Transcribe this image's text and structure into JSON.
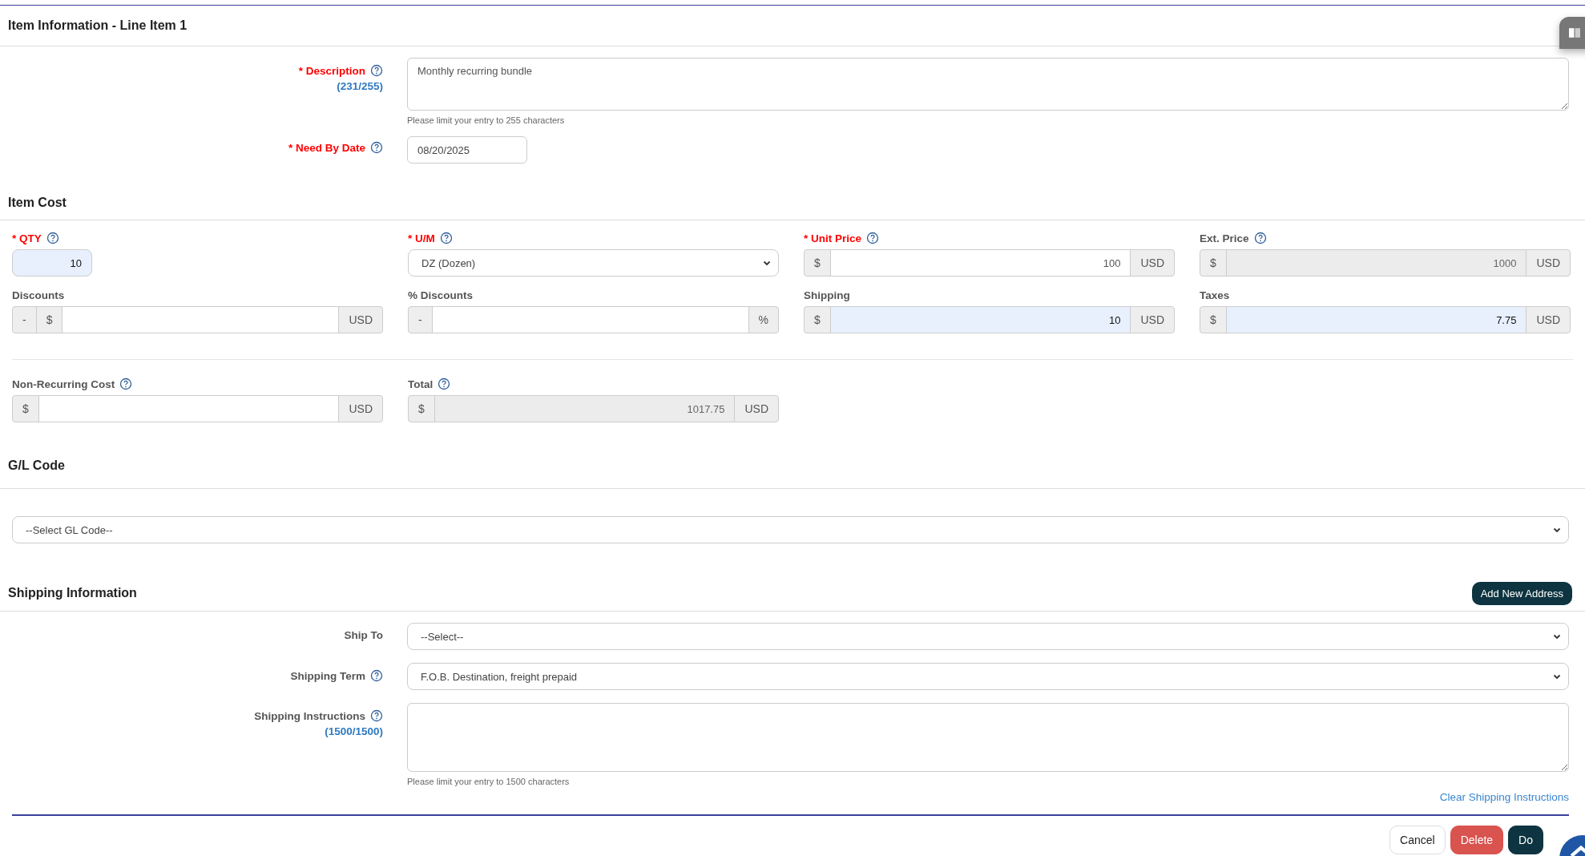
{
  "header": {
    "title": "Item Information - Line Item 1"
  },
  "item_info": [
    {
      "kind": "textarea",
      "label": "* Description",
      "required": true,
      "help": true,
      "counter": "(231/255)",
      "value": "Monthly recurring bundle",
      "hint": "Please limit your entry to 255 characters"
    },
    {
      "kind": "date",
      "label": "* Need By Date",
      "required": true,
      "help": true,
      "value": "08/20/2025"
    }
  ],
  "item_cost": {
    "title": "Item Cost",
    "groups": [
      [
        {
          "kind": "number",
          "label": "* QTY",
          "required": true,
          "help": true,
          "value": "10",
          "highlighted": true
        },
        {
          "kind": "select",
          "label": "* U/M",
          "required": true,
          "help": true,
          "value": "DZ (Dozen)"
        },
        {
          "kind": "money",
          "label": "* Unit Price",
          "required": true,
          "help": true,
          "prefix": [
            "$"
          ],
          "value": "100",
          "suffix": "USD",
          "highlighted": false,
          "readonly": false
        },
        {
          "kind": "money",
          "label": "Ext. Price",
          "required": false,
          "help": true,
          "prefix": [
            "$"
          ],
          "value": "1000",
          "suffix": "USD",
          "readonly": true
        },
        {
          "kind": "money",
          "label": "Discounts",
          "required": false,
          "prefix": [
            "-",
            "$"
          ],
          "suffix": "USD",
          "highlighted": false,
          "readonly": false
        },
        {
          "kind": "money",
          "label": "% Discounts",
          "required": false,
          "prefix": [
            "-"
          ],
          "suffix": "%",
          "highlighted": false,
          "readonly": false
        },
        {
          "kind": "money",
          "label": "Shipping",
          "required": false,
          "prefix": [
            "$"
          ],
          "value": "10",
          "suffix": "USD",
          "highlighted": true,
          "readonly": false
        },
        {
          "kind": "money",
          "label": "Taxes",
          "required": false,
          "prefix": [
            "$"
          ],
          "value": "7.75",
          "suffix": "USD",
          "highlighted": true,
          "readonly": false
        }
      ],
      [
        {
          "kind": "money",
          "label": "Non-Recurring Cost",
          "required": false,
          "help": true,
          "prefix": [
            "$"
          ],
          "suffix": "USD",
          "highlighted": false,
          "readonly": false
        },
        {
          "kind": "money",
          "label": "Total",
          "required": false,
          "help": true,
          "prefix": [
            "$"
          ],
          "value": "1017.75",
          "suffix": "USD",
          "readonly": true
        }
      ]
    ]
  },
  "gl_code": {
    "title": "G/L Code",
    "value": "--Select GL Code--"
  },
  "shipping": {
    "title": "Shipping Information",
    "button": "Add New Address",
    "fields": [
      {
        "kind": "select",
        "label": "Ship To",
        "required": false,
        "value": "--Select--"
      },
      {
        "kind": "select",
        "label": "Shipping Term",
        "required": false,
        "help": true,
        "value": "F.O.B. Destination, freight prepaid"
      },
      {
        "kind": "textarea",
        "label": "Shipping Instructions",
        "required": false,
        "help": true,
        "counter": "(1500/1500)",
        "hint": "Please limit your entry to 1500 characters"
      }
    ],
    "link": "Clear Shipping Instructions"
  },
  "footer": {
    "buttons": [
      {
        "label": "Cancel",
        "kind": "plain"
      },
      {
        "label": "Delete",
        "kind": "danger"
      },
      {
        "label": "Do",
        "kind": "dark"
      }
    ]
  }
}
